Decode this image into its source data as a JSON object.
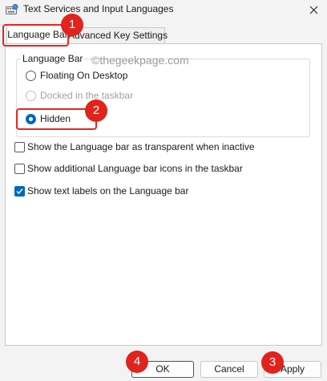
{
  "window": {
    "title": "Text Services and Input Languages",
    "icon": "keyboard-globe-icon",
    "close_icon": "close-icon"
  },
  "tabs": [
    {
      "label": "Language Bar",
      "active": true
    },
    {
      "label": "Advanced Key Settings",
      "active": false
    }
  ],
  "group": {
    "legend": "Language Bar",
    "options": [
      {
        "label": "Floating On Desktop",
        "checked": false,
        "disabled": false
      },
      {
        "label": "Docked in the taskbar",
        "checked": false,
        "disabled": true
      },
      {
        "label": "Hidden",
        "checked": true,
        "disabled": false
      }
    ]
  },
  "checkboxes": [
    {
      "label": "Show the Language bar as transparent when inactive",
      "checked": false
    },
    {
      "label": "Show additional Language bar icons in the taskbar",
      "checked": false
    },
    {
      "label": "Show text labels on the Language bar",
      "checked": true
    }
  ],
  "watermark": "©thegeekpage.com",
  "buttons": {
    "ok": "OK",
    "cancel": "Cancel",
    "apply": "Apply"
  },
  "annotations": {
    "badge1": "1",
    "badge2": "2",
    "badge3": "3",
    "badge4": "4",
    "color": "#e0231c"
  },
  "colors": {
    "accent": "#0067c0",
    "annotation_red": "#e0231c"
  }
}
